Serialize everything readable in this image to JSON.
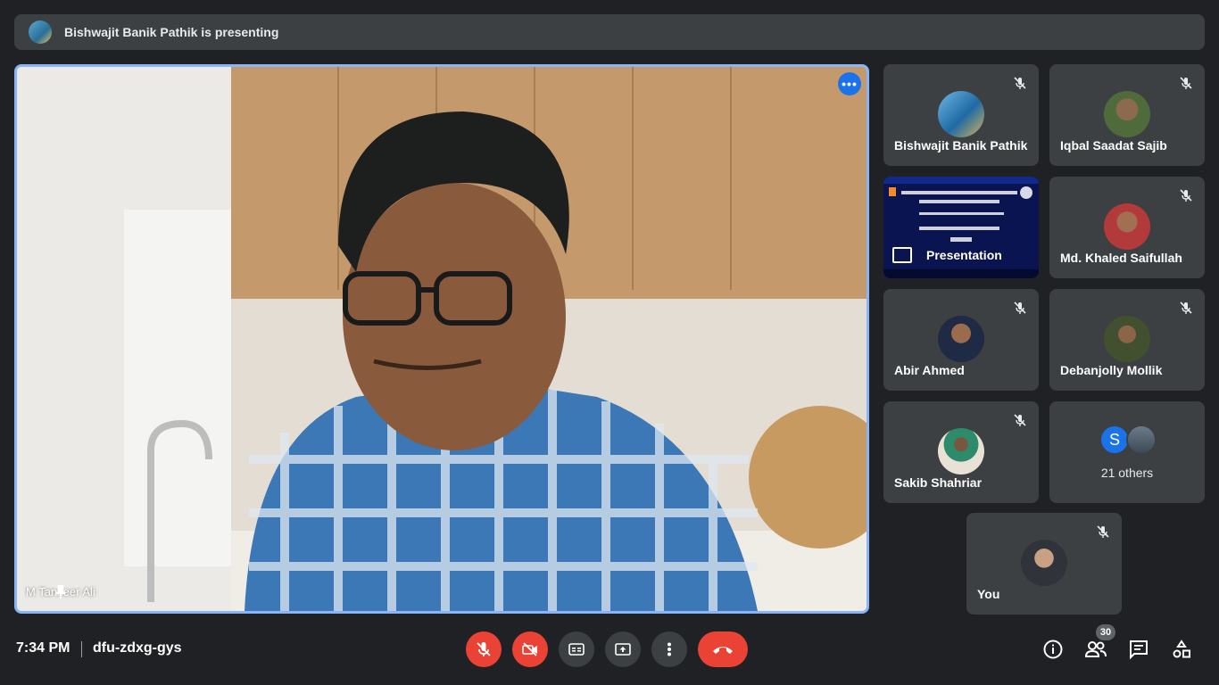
{
  "banner": {
    "text": "Bishwajit Banik Pathik is presenting"
  },
  "main": {
    "speaker_name": "M Tanseer Ali",
    "more_label": "•••"
  },
  "participants": [
    {
      "name": "Bishwajit Banik Pathik",
      "muted": true
    },
    {
      "name": "Iqbal Saadat Sajib",
      "muted": true
    },
    {
      "name": "Md. Khaled Saifullah",
      "muted": true
    },
    {
      "name": "Abir Ahmed",
      "muted": true
    },
    {
      "name": "Debanjolly Mollik",
      "muted": true
    },
    {
      "name": "Sakib Shahriar",
      "muted": true
    },
    {
      "name": "You",
      "muted": true
    }
  ],
  "presentation_tile": {
    "label": "Presentation"
  },
  "others": {
    "count_label": "21 others",
    "initial": "S"
  },
  "bottom": {
    "time": "7:34 PM",
    "meeting_code": "dfu-zdxg-gys",
    "people_count": "30"
  },
  "colors": {
    "accent": "#8ab4f8",
    "danger": "#ea4335",
    "surface": "#3c4043",
    "background": "#202124"
  }
}
